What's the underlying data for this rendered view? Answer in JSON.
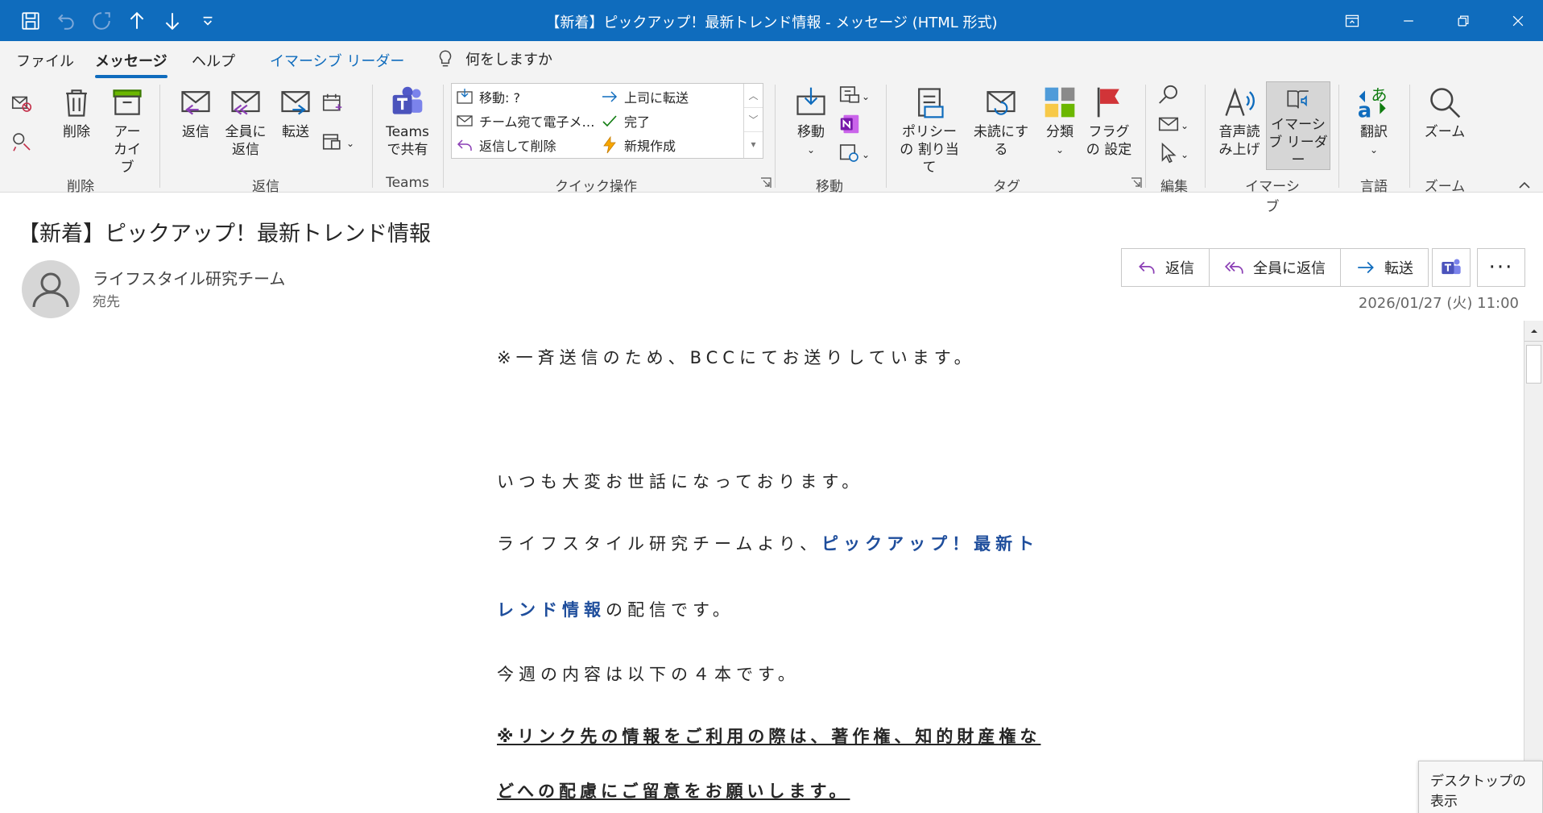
{
  "window": {
    "title": "【新着】ピックアップ！最新トレンド情報 - メッセージ (HTML 形式)"
  },
  "menu": {
    "tabs": [
      "ファイル",
      "メッセージ",
      "ヘルプ",
      "イマーシブ リーダー"
    ],
    "active": "メッセージ",
    "tell_me": "何をしますか"
  },
  "ribbon": {
    "delete": {
      "delete_label": "削除",
      "archive_label": "アー カイブ",
      "group": "削除"
    },
    "respond": {
      "reply": "返信",
      "reply_all": "全員に 返信",
      "forward": "転送",
      "group": "返信"
    },
    "teams": {
      "share": "Teams で共有",
      "group": "Teams"
    },
    "quick_steps": {
      "items": [
        "移動: ?",
        "上司に転送",
        "チーム宛て電子メ…",
        "完了",
        "返信して削除",
        "新規作成"
      ],
      "group": "クイック操作"
    },
    "move": {
      "move": "移動",
      "group": "移動"
    },
    "tags": {
      "policy": "ポリシーの 割り当て",
      "unread": "未読にする",
      "categorize": "分類",
      "flag": "フラグの 設定",
      "group": "タグ"
    },
    "editing": {
      "group": "編集"
    },
    "immersive": {
      "read_aloud": "音声読 み上げ",
      "reader": "イマーシ ブ リーダー",
      "group": "イマーシブ"
    },
    "language": {
      "translate": "翻訳",
      "group": "言語"
    },
    "zoom": {
      "zoom": "ズーム",
      "group": "ズーム"
    }
  },
  "message": {
    "subject": "【新着】ピックアップ！最新トレンド情報",
    "sender": "ライフスタイル研究チーム",
    "to_label": "宛先",
    "actions": {
      "reply": "返信",
      "reply_all": "全員に返信",
      "forward": "転送"
    },
    "timestamp": "2026/01/27 (火) 11:00"
  },
  "body": {
    "bcc_notice": "※一斉送信のため、BCCにてお送りしています。",
    "greeting": "いつも大変お世話になっております。",
    "intro_prefix": "ライフスタイル研究チームより、",
    "intro_highlight_1": "ピックアップ！最新ト",
    "intro_highlight_2": "レンド情報",
    "intro_suffix": "の配信です。",
    "contents": "今週の内容は以下の４本です。",
    "warning_1": "※リンク先の情報をご利用の際は、著作権、知的財産権な",
    "warning_2": "どへの配慮にご留意をお願いします。"
  },
  "tooltip": "デスクトップの表示"
}
